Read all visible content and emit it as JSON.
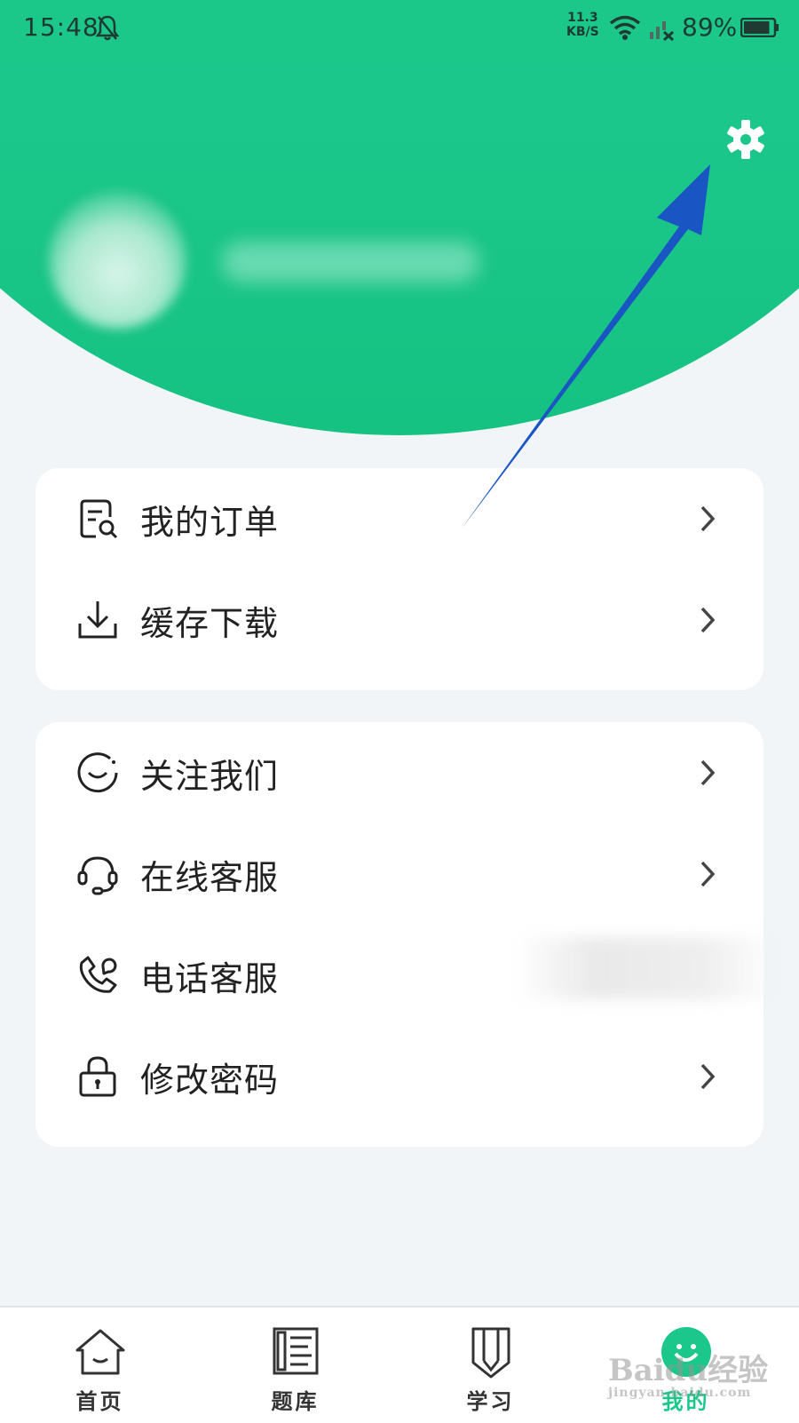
{
  "status_bar": {
    "time": "15:48",
    "net_speed_value": "11.3",
    "net_speed_unit": "KB/S",
    "battery_percent": "89%",
    "battery_level": 0.89
  },
  "colors": {
    "brand": "#1bc78a",
    "background": "#f2f5f8",
    "text": "#222222",
    "annotation_arrow": "#1a55c4"
  },
  "profile": {
    "settings_icon": "gear-icon"
  },
  "menu_group_1": [
    {
      "label": "我的订单",
      "icon": "order-search-icon"
    },
    {
      "label": "缓存下载",
      "icon": "download-icon"
    }
  ],
  "menu_group_2": [
    {
      "label": "关注我们",
      "icon": "smile-circle-icon"
    },
    {
      "label": "在线客服",
      "icon": "headset-icon"
    },
    {
      "label": "电话客服",
      "icon": "phone-icon"
    },
    {
      "label": "修改密码",
      "icon": "lock-icon"
    }
  ],
  "tabbar": [
    {
      "label": "首页",
      "icon": "home-icon"
    },
    {
      "label": "题库",
      "icon": "question-bank-icon"
    },
    {
      "label": "学习",
      "icon": "pencil-book-icon"
    },
    {
      "label": "我的",
      "icon": "profile-icon",
      "active": true
    }
  ],
  "watermark": {
    "brand": "Baidu经验",
    "url": "jingyan.baidu.com"
  }
}
